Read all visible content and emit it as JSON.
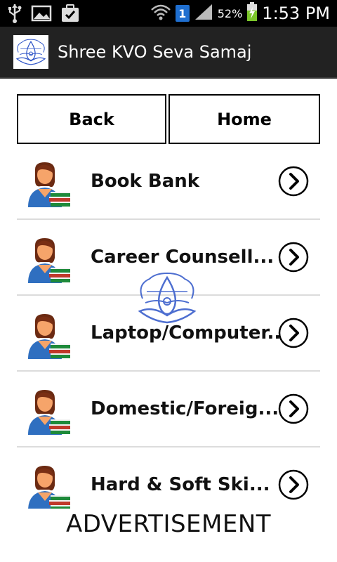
{
  "status_bar": {
    "time": "1:53 PM",
    "battery_percent": "52%",
    "sim_slot": "1",
    "left_icons": [
      "usb-icon",
      "image-icon",
      "task-done-icon"
    ],
    "right_icons": [
      "wifi-icon",
      "sim-icon",
      "signal-icon",
      "battery-charging-icon"
    ]
  },
  "action_bar": {
    "title": "Shree KVO Seva Samaj",
    "logo_icon": "samaj-logo-icon"
  },
  "nav": {
    "back_label": "Back",
    "home_label": "Home"
  },
  "list": {
    "items": [
      {
        "label": "Book Bank",
        "icon": "student-books-icon",
        "action_icon": "chevron-right-circle-icon"
      },
      {
        "label": "Career Counsell...",
        "icon": "student-books-icon",
        "action_icon": "chevron-right-circle-icon"
      },
      {
        "label": "Laptop/Computer...",
        "icon": "student-books-icon",
        "action_icon": "chevron-right-circle-icon"
      },
      {
        "label": "Domestic/Foreig...",
        "icon": "student-books-icon",
        "action_icon": "chevron-right-circle-icon"
      },
      {
        "label": "Hard & Soft Ski...",
        "icon": "student-books-icon",
        "action_icon": "chevron-right-circle-icon"
      }
    ]
  },
  "advertisement": {
    "label": "ADVERTISEMENT"
  },
  "colors": {
    "status_bar_bg": "#000000",
    "action_bar_bg": "#222222",
    "logo_blue": "#2f55c8",
    "battery_green": "#7cc72a",
    "sim_blue": "#1f6fd0"
  }
}
